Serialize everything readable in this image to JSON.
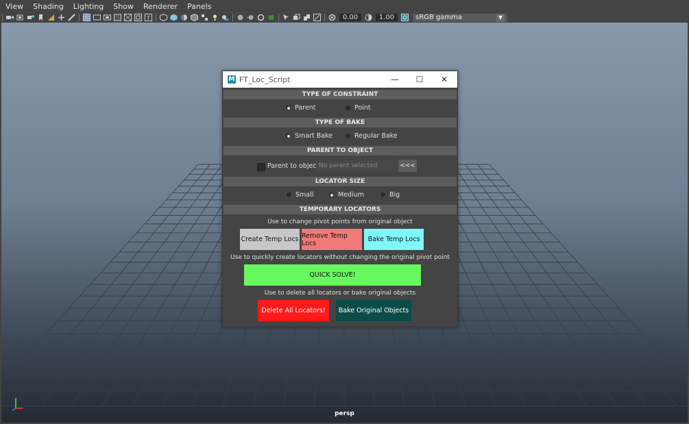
{
  "menubar": {
    "items": [
      "View",
      "Shading",
      "Lighting",
      "Show",
      "Renderer",
      "Panels"
    ]
  },
  "toolbar": {
    "exposure_value": "0.00",
    "gamma_value": "1.00",
    "color_space": "sRGB gamma",
    "dropdown_glyph": "▼"
  },
  "viewport": {
    "camera_label": "persp",
    "grid_color": "#3a3f46"
  },
  "dialog": {
    "title": "FT_Loc_Script",
    "icon_letter": "M",
    "window_controls": {
      "minimize": "—",
      "maximize": "☐",
      "close": "✕"
    },
    "constraint": {
      "header": "TYPE OF CONSTRAINT",
      "options": [
        "Parent",
        "Point"
      ],
      "selected": "Parent"
    },
    "bake": {
      "header": "TYPE OF BAKE",
      "options": [
        "Smart Bake",
        "Regular Bake"
      ],
      "selected": "Smart Bake"
    },
    "parent": {
      "header": "PARENT TO OBJECT",
      "checkbox_label": "Parent to object",
      "checked": false,
      "field_placeholder": "No parent selected",
      "pick_button": "<<<"
    },
    "locator_size": {
      "header": "LOCATOR SIZE",
      "options": [
        "Small",
        "Medium",
        "Big"
      ],
      "selected": "Medium"
    },
    "temp_locators": {
      "header": "TEMPORARY LOCATORS",
      "hint1": "Use to change pivot points from original object",
      "create_button": "Create Temp Locs",
      "remove_button": "Remove Temp Locs",
      "bake_button": "Bake Temp Locs",
      "hint2": "Use to quickly create locators without changing the original pivot point",
      "quick_solve_button": "QUICK SOLVE!",
      "hint3": "Use to delete all locators or bake original objects",
      "delete_button": "Delete All Locators!",
      "bake_original_button": "Bake Original Objects"
    },
    "colors": {
      "create": "#c8c8c8",
      "remove": "#f07a7a",
      "bake": "#7ff7f9",
      "quick_solve": "#66fa5e",
      "delete": "#ff1a1a",
      "bake_original": "#0c4c48"
    }
  }
}
